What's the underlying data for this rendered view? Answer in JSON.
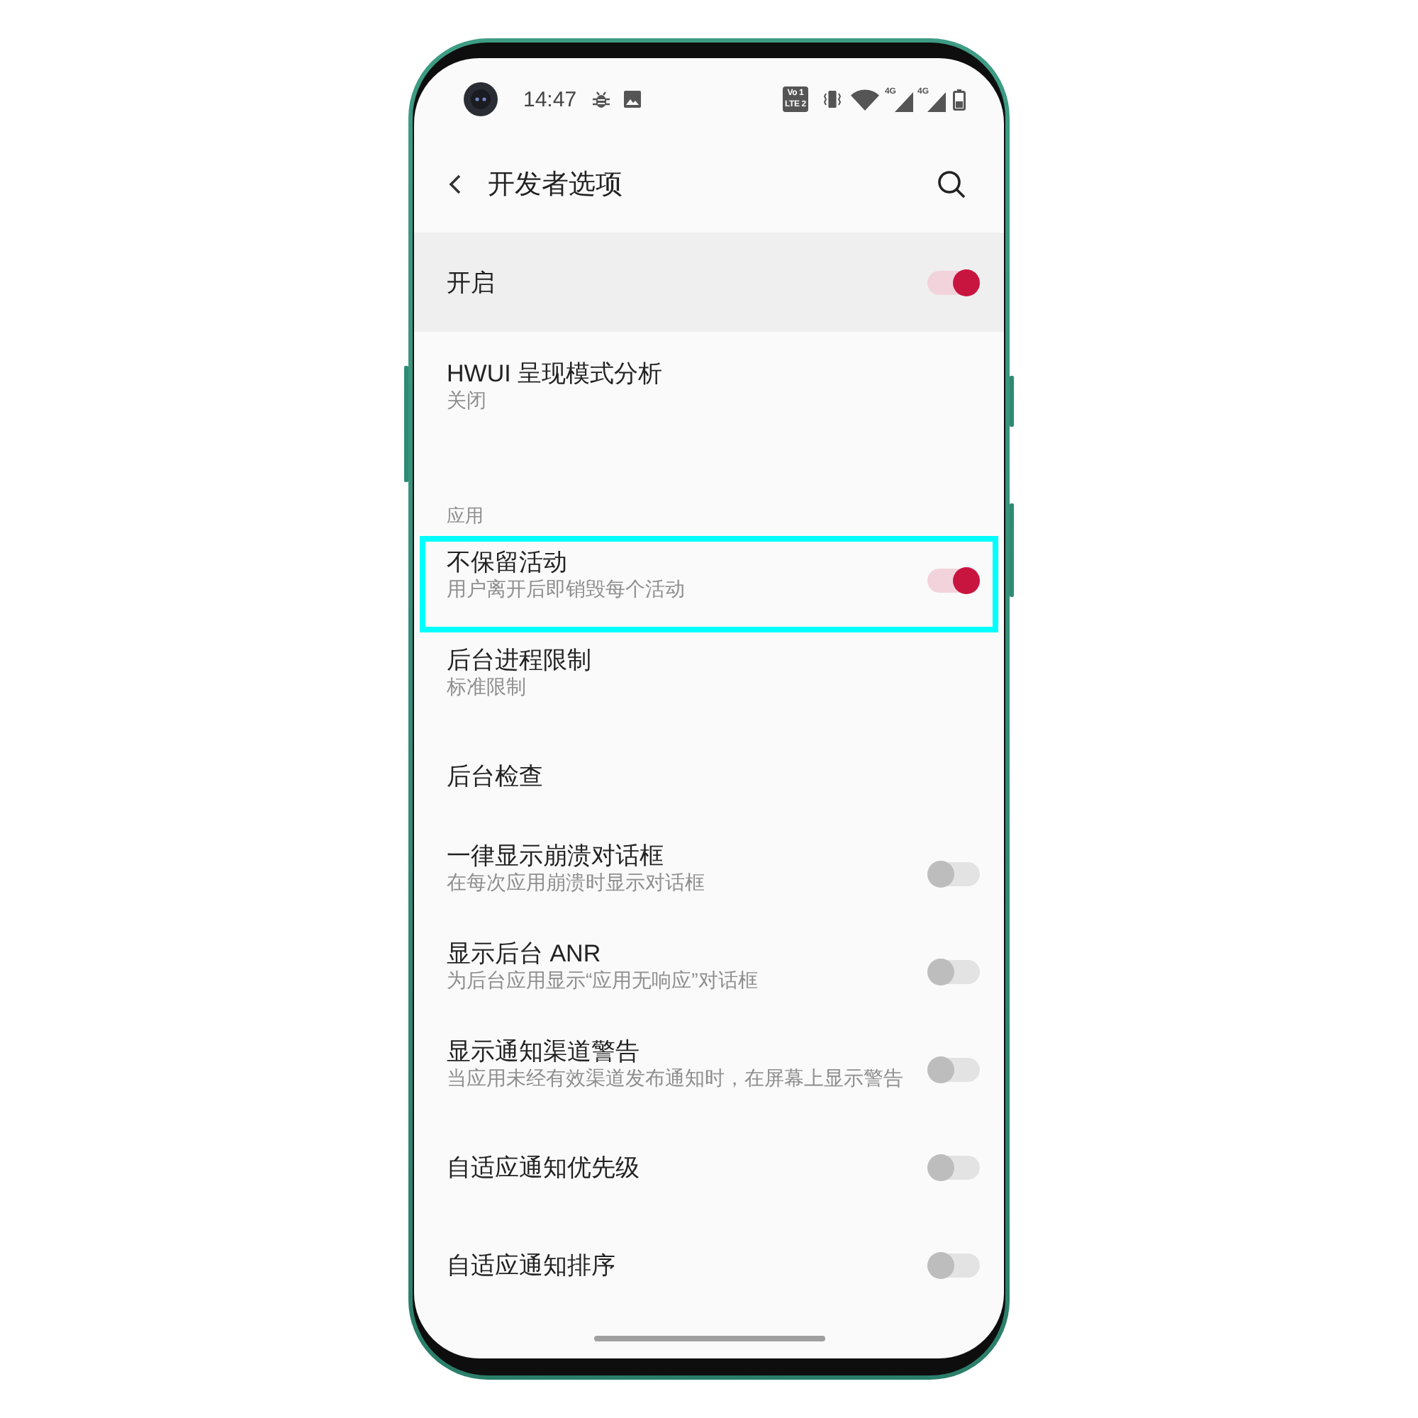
{
  "status_bar": {
    "time": "14:47",
    "volte_badge": {
      "line_1": "Vo 1",
      "line_2": "LTE 2"
    },
    "signals": [
      {
        "network": "4G"
      },
      {
        "network": "4G"
      }
    ]
  },
  "header": {
    "title": "开发者选项"
  },
  "master_switch": {
    "label": "开启",
    "on": true
  },
  "items": [
    {
      "kind": "setting",
      "title": "HWUI 呈现模式分析",
      "subtitle": "关闭",
      "highlighted": false
    },
    {
      "kind": "section",
      "title": "应用"
    },
    {
      "kind": "toggle",
      "title": "不保留活动",
      "subtitle": "用户离开后即销毁每个活动",
      "on": true,
      "highlighted": true
    },
    {
      "kind": "setting",
      "title": "后台进程限制",
      "subtitle": "标准限制",
      "highlighted": false
    },
    {
      "kind": "setting",
      "title": "后台检查",
      "highlighted": false
    },
    {
      "kind": "toggle",
      "title": "一律显示崩溃对话框",
      "subtitle": "在每次应用崩溃时显示对话框",
      "on": false,
      "highlighted": false
    },
    {
      "kind": "toggle",
      "title": "显示后台 ANR",
      "subtitle": "为后台应用显示“应用无响应”对话框",
      "on": false,
      "highlighted": false
    },
    {
      "kind": "toggle",
      "title": "显示通知渠道警告",
      "subtitle": "当应用未经有效渠道发布通知时，在屏幕上显示警告",
      "on": false,
      "highlighted": false
    },
    {
      "kind": "toggle",
      "title": "自适应通知优先级",
      "on": false,
      "highlighted": false
    },
    {
      "kind": "toggle",
      "title": "自适应通知排序",
      "on": false,
      "highlighted": false
    }
  ]
}
